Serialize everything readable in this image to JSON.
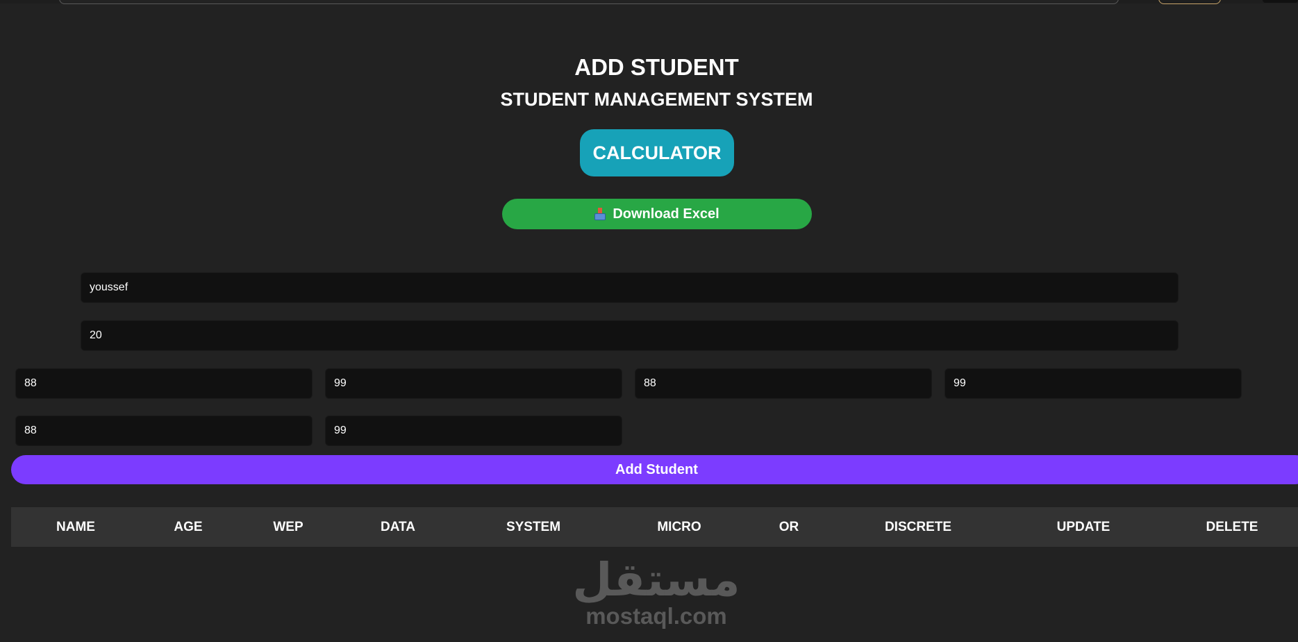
{
  "header": {
    "title": "ADD STUDENT",
    "subtitle": "STUDENT MANAGEMENT SYSTEM"
  },
  "toolbar": {
    "calculator_label": "CALCULATOR",
    "download_label": "Download Excel",
    "download_icon": "download-tray-icon"
  },
  "form": {
    "name_value": "youssef",
    "age_value": "20",
    "grades": [
      "88",
      "99",
      "88",
      "99",
      "88",
      "99"
    ],
    "submit_label": "Add Student"
  },
  "table": {
    "columns": [
      "NAME",
      "AGE",
      "WEP",
      "DATA",
      "SYSTEM",
      "MICRO",
      "OR",
      "DISCRETE",
      "UPDATE",
      "DELETE"
    ],
    "rows": []
  },
  "watermark": {
    "arabic": "مستقل",
    "latin": "mostaql.com"
  },
  "colors": {
    "background": "#222222",
    "calculator": "#17a2b8",
    "download": "#28a745",
    "submit": "#7c3cff",
    "table_header": "#333333",
    "field": "#111111"
  }
}
